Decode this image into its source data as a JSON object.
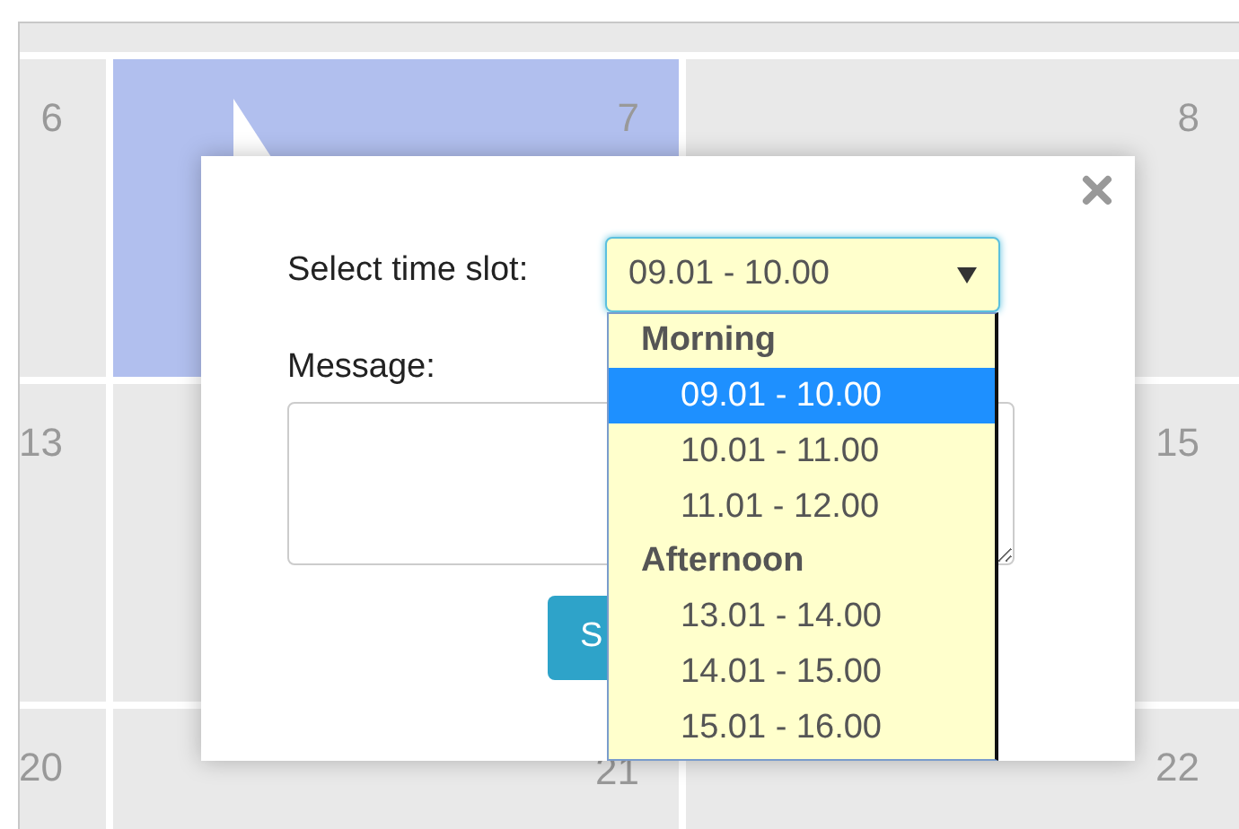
{
  "calendar": {
    "weeks": [
      {
        "days": [
          {
            "label": "6",
            "selected": false
          },
          {
            "label": "7",
            "selected": true
          },
          {
            "label": "8",
            "selected": false
          }
        ]
      },
      {
        "days": [
          {
            "label": "13",
            "selected": false
          },
          {
            "selected": false
          },
          {
            "label": "15",
            "selected": false
          }
        ]
      },
      {
        "days": [
          {
            "label": "20",
            "selected": false
          },
          {
            "label": "21",
            "selected": false
          },
          {
            "label": "22",
            "selected": false
          }
        ]
      }
    ]
  },
  "popup": {
    "time_slot": {
      "label": "Select time slot:",
      "value": "09.01 - 10.00",
      "expanded": true,
      "groups": [
        {
          "label": "Morning",
          "options": [
            {
              "label": "09.01 - 10.00",
              "selected": true
            },
            {
              "label": "10.01 - 11.00",
              "selected": false
            },
            {
              "label": "11.01 - 12.00",
              "selected": false
            }
          ]
        },
        {
          "label": "Afternoon",
          "options": [
            {
              "label": "13.01 - 14.00",
              "selected": false
            },
            {
              "label": "14.01 - 15.00",
              "selected": false
            },
            {
              "label": "15.01 - 16.00",
              "selected": false
            }
          ]
        }
      ]
    },
    "message": {
      "label": "Message:"
    },
    "submit_button": "S"
  }
}
